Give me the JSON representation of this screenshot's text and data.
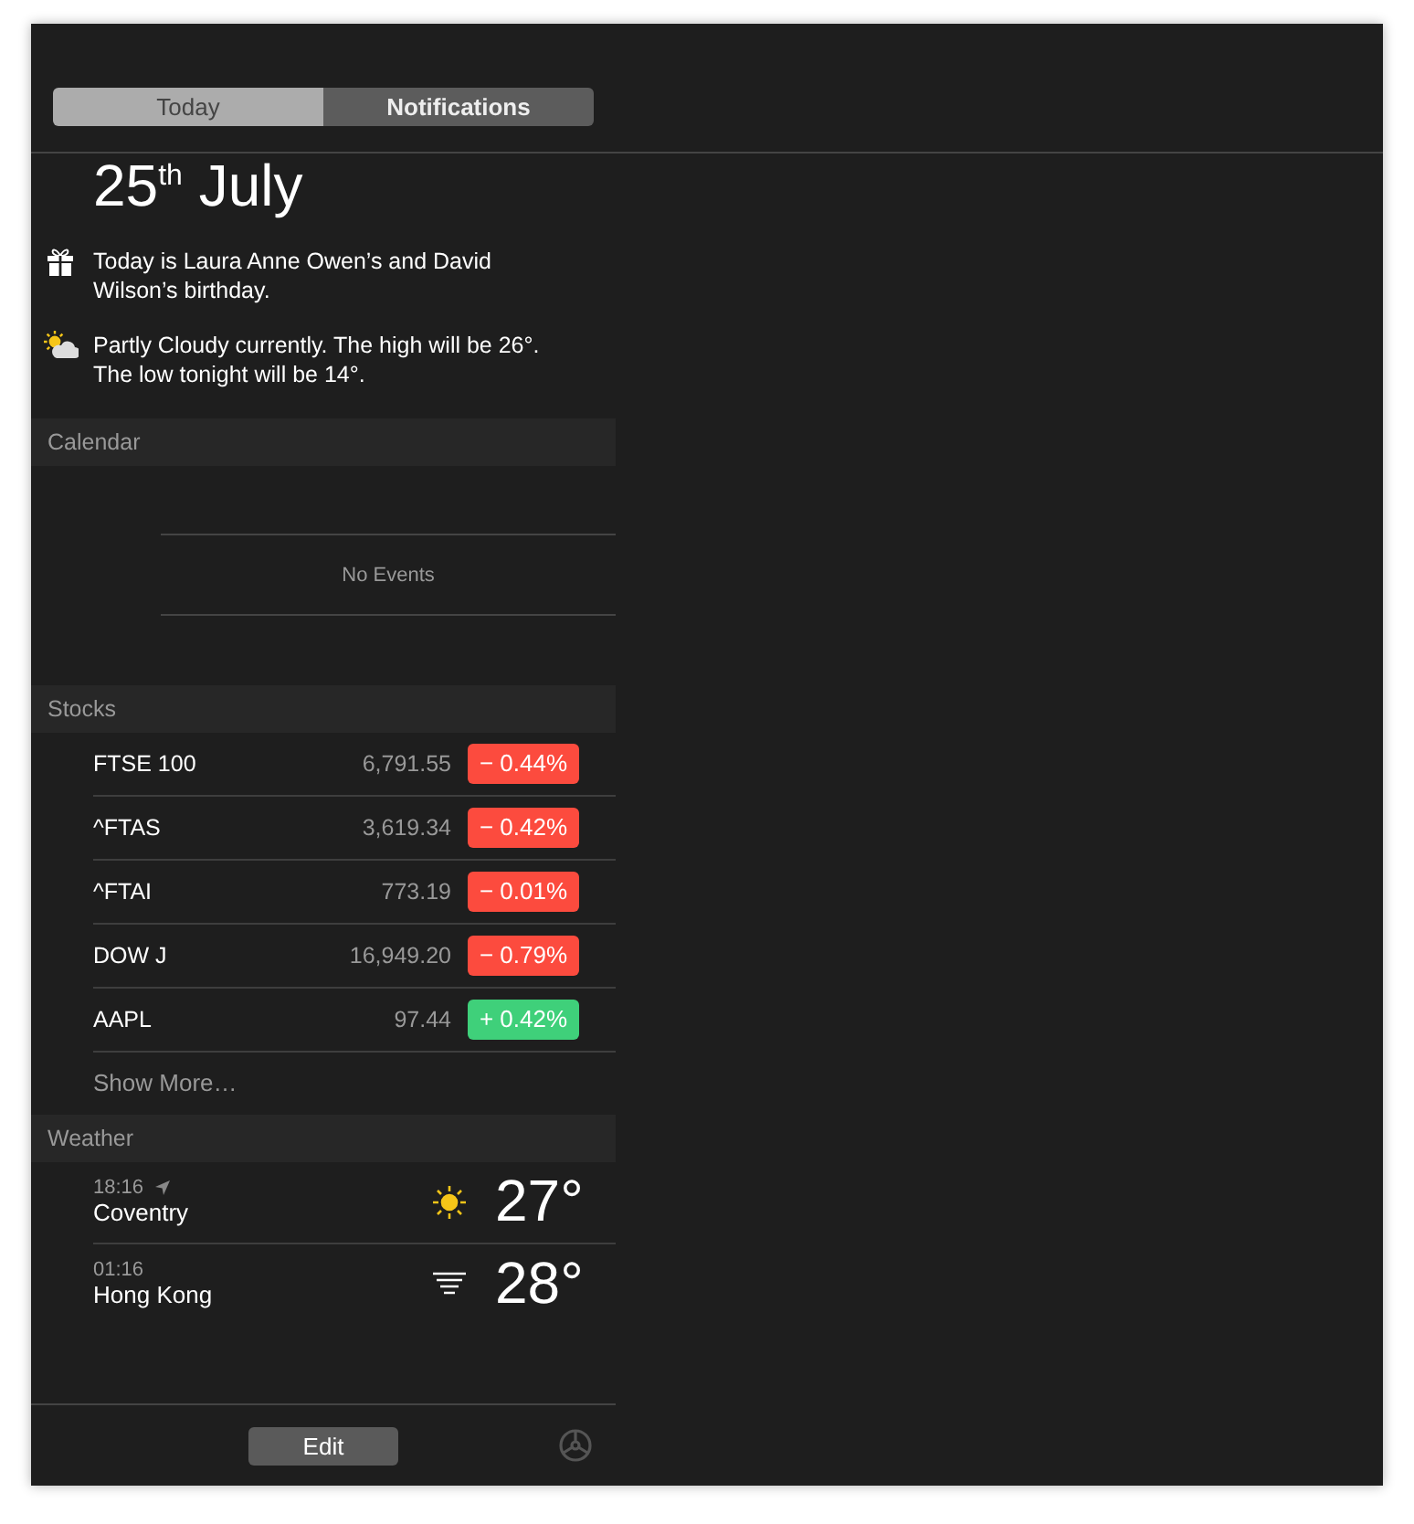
{
  "tabs": [
    {
      "label": "Today",
      "selected": true
    },
    {
      "label": "Notifications",
      "selected": false
    }
  ],
  "date": "25$^{th}$ July",
  "notices": [
    {
      "kind": "birthday",
      "text": "Today is Laura Anne Owen’s and David Wilson’s birthday."
    },
    {
      "kind": "weather",
      "text": "Partly Cloudy currently. The high will be 26°. The low tonight will be 14°."
    }
  ],
  "calendar": {
    "title": "Calendar",
    "empty_text": "No Events"
  },
  "stocks": {
    "title": "Stocks",
    "rows": [
      {
        "symbol": "FTSE 100",
        "price": "6,791.55",
        "change": "− 0.44%",
        "color": "#fc4b3e"
      },
      {
        "symbol": "^FTAS",
        "price": "3,619.34",
        "change": "− 0.42%",
        "color": "#fc4b3e"
      },
      {
        "symbol": "^FTAI",
        "price": "773.19",
        "change": "− 0.01%",
        "color": "#fc4b3e"
      },
      {
        "symbol": "DOW J",
        "price": "16,949.20",
        "change": "− 0.79%",
        "color": "#fc4b3e"
      },
      {
        "symbol": "AAPL",
        "price": "97.44",
        "change": "+ 0.42%",
        "color": "#3fd07a"
      }
    ],
    "show_more": "Show More…"
  },
  "weather": {
    "title": "Weather",
    "rows": [
      {
        "time": "18:16",
        "current_location": true,
        "city": "Coventry",
        "kind": "sunny",
        "temperature": "27°"
      },
      {
        "time": "01:16",
        "current_location": false,
        "city": "Hong Kong",
        "kind": "fog",
        "temperature": "28°"
      }
    ]
  },
  "footer": {
    "edit_button": "Edit"
  }
}
